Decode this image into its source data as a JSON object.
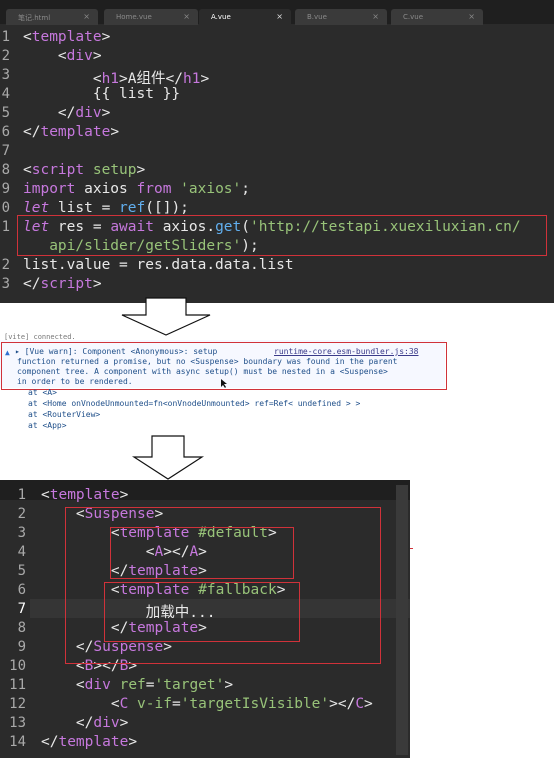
{
  "top_editor": {
    "tabs": [
      {
        "label": "笔记.html",
        "close": "×",
        "active": false
      },
      {
        "label": "Home.vue",
        "close": "×",
        "active": false
      },
      {
        "label": "A.vue",
        "close": "×",
        "active": true
      },
      {
        "label": "B.vue",
        "close": "×",
        "active": false
      },
      {
        "label": "C.vue",
        "close": "×",
        "active": false
      }
    ],
    "line_numbers": [
      "1",
      "2",
      "3",
      "4",
      "5",
      "6",
      "7",
      "8",
      "9",
      "0",
      "1",
      "2",
      "",
      "3",
      "3"
    ]
  },
  "console": {
    "top_cut_text": "[vite] connected.",
    "warn_lines": [
      "▸ [Vue warn]: Component <Anonymous>: setup",
      "function returned a promise, but no <Suspense> boundary was found in the parent",
      "component tree. A component with async setup() must be nested in a <Suspense>",
      "in order to be rendered."
    ],
    "warn_link": "runtime-core.esm-bundler.js:38",
    "trace_lines": [
      "at <A>",
      "at <Home onVnodeUnmounted=fn<onVnodeUnmounted> ref=Ref< undefined > >",
      "at <RouterView>",
      "at <App>"
    ]
  },
  "bottom_editor": {
    "line_numbers": [
      "1",
      "2",
      "3",
      "4",
      "5",
      "6",
      "7",
      "8",
      "9",
      "10",
      "11",
      "12",
      "13",
      "14"
    ]
  },
  "colors": {
    "editor_bg": "#2b2b2b",
    "tag": "#c678dd",
    "string": "#98c379",
    "function": "#61afef",
    "highlight_box": "#d0323a",
    "console_text": "#1f4f8a"
  }
}
